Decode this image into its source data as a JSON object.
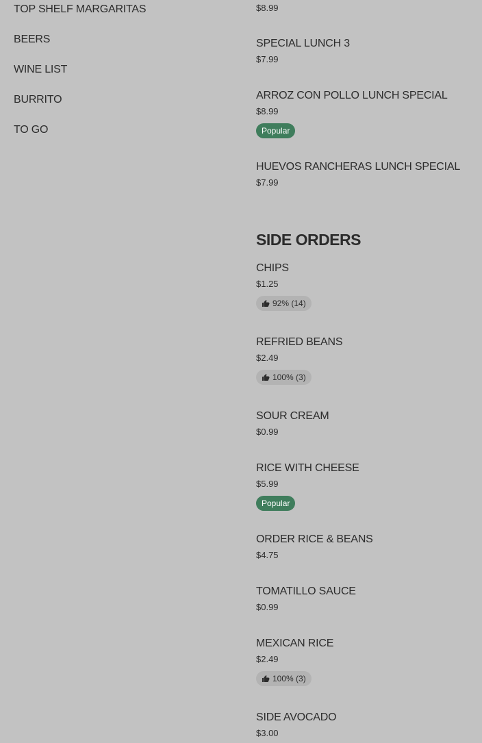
{
  "sidebar": {
    "categories": [
      {
        "label": "TOP SHELF MARGARITAS"
      },
      {
        "label": "BEERS"
      },
      {
        "label": "WINE LIST"
      },
      {
        "label": "BURRITO"
      },
      {
        "label": "TO GO"
      }
    ]
  },
  "lunch_specials": {
    "top_price": "$8.99",
    "items": [
      {
        "name": "SPECIAL LUNCH 3",
        "price": "$7.99"
      },
      {
        "name": "ARROZ CON POLLO LUNCH SPECIAL",
        "price": "$8.99",
        "badge": "Popular"
      },
      {
        "name": "HUEVOS RANCHERAS LUNCH SPECIAL",
        "price": "$7.99"
      }
    ]
  },
  "side_orders": {
    "title": "SIDE ORDERS",
    "items": [
      {
        "name": "CHIPS",
        "price": "$1.25",
        "rating": "92% (14)"
      },
      {
        "name": "REFRIED BEANS",
        "price": "$2.49",
        "rating": "100% (3)"
      },
      {
        "name": "SOUR CREAM",
        "price": "$0.99"
      },
      {
        "name": "RICE WITH CHEESE",
        "price": "$5.99",
        "badge": "Popular"
      },
      {
        "name": "ORDER RICE & BEANS",
        "price": "$4.75"
      },
      {
        "name": "TOMATILLO SAUCE",
        "price": "$0.99"
      },
      {
        "name": "MEXICAN RICE",
        "price": "$2.49",
        "rating": "100% (3)"
      },
      {
        "name": "SIDE AVOCADO",
        "price": "$3.00"
      }
    ]
  },
  "icons": {
    "rating": "thumbs-up-icon"
  },
  "colors": {
    "background": "#c2c2c2",
    "text": "#2c2c2c",
    "popular_badge": "#3f7d5c",
    "rating_badge": "#b3b3b3"
  }
}
